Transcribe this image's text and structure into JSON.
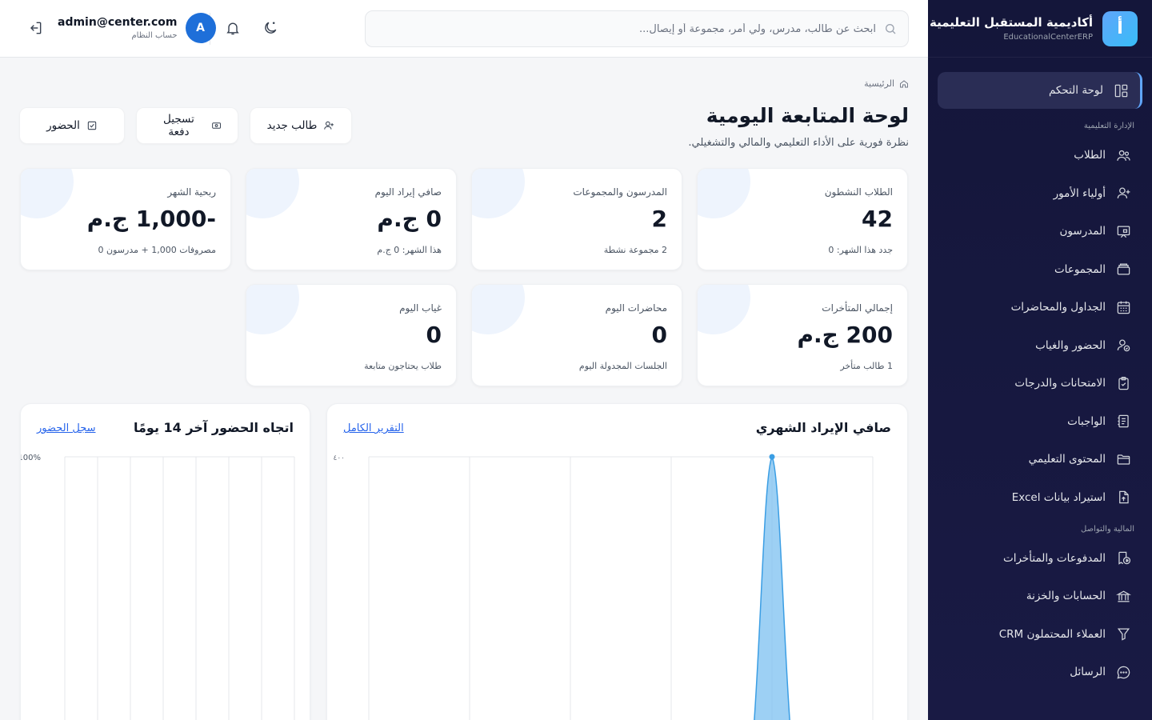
{
  "brand": {
    "name": "أكاديمية المستقبل التعليمية",
    "subtitle": "EducationalCenterERP",
    "logo_letter": "أ"
  },
  "sidebar": {
    "active": {
      "label": "لوحة التحكم",
      "icon": "dashboard-icon"
    },
    "sections": [
      {
        "title": "الإدارة التعليمية",
        "items": [
          {
            "label": "الطلاب",
            "icon": "users-icon"
          },
          {
            "label": "أولياء الأمور",
            "icon": "user-plus-icon"
          },
          {
            "label": "المدرسون",
            "icon": "presentation-icon"
          },
          {
            "label": "المجموعات",
            "icon": "archive-icon"
          },
          {
            "label": "الجداول والمحاضرات",
            "icon": "calendar-icon"
          },
          {
            "label": "الحضور والغياب",
            "icon": "user-check-icon"
          },
          {
            "label": "الامتحانات والدرجات",
            "icon": "clipboard-icon"
          },
          {
            "label": "الواجبات",
            "icon": "notebook-icon"
          },
          {
            "label": "المحتوى التعليمي",
            "icon": "folder-icon"
          },
          {
            "label": "استيراد بيانات Excel",
            "icon": "file-upload-icon"
          }
        ]
      },
      {
        "title": "المالية والتواصل",
        "items": [
          {
            "label": "المدفوعات والمتأخرات",
            "icon": "receipt-icon"
          },
          {
            "label": "الحسابات والخزنة",
            "icon": "bank-icon"
          },
          {
            "label": "العملاء المحتملون CRM",
            "icon": "funnel-icon"
          },
          {
            "label": "الرسائل",
            "icon": "chat-icon"
          }
        ]
      }
    ]
  },
  "header": {
    "search_placeholder": "ابحث عن طالب، مدرس، ولي أمر، مجموعة أو إيصال...",
    "user_email": "admin@center.com",
    "user_role": "حساب النظام",
    "avatar_letter": "A"
  },
  "page": {
    "breadcrumb": "الرئيسية",
    "title": "لوحة المتابعة اليومية",
    "subtitle": "نظرة فورية على الأداء التعليمي والمالي والتشغيلي."
  },
  "actions": {
    "new_student": "طالب جديد",
    "record_payment": "تسجيل دفعة",
    "attendance": "الحضور"
  },
  "stats": [
    {
      "label": "الطلاب النشطون",
      "value": "42",
      "foot": "جدد هذا الشهر: 0"
    },
    {
      "label": "المدرسون والمجموعات",
      "value": "2",
      "foot": "2 مجموعة نشطة"
    },
    {
      "label": "صافي إيراد اليوم",
      "value": "0 ج.م",
      "foot": "هذا الشهر: 0 ج.م"
    },
    {
      "label": "ربحية الشهر",
      "value": "-1,000 ج.م",
      "foot": "مصروفات 1,000 + مدرسون 0"
    },
    {
      "label": "إجمالي المتأخرات",
      "value": "200 ج.م",
      "foot": "1 طالب متأخر"
    },
    {
      "label": "محاضرات اليوم",
      "value": "0",
      "foot": "الجلسات المجدولة اليوم"
    },
    {
      "label": "غياب اليوم",
      "value": "0",
      "foot": "طلاب يحتاجون متابعة"
    }
  ],
  "panels": {
    "revenue": {
      "title": "صافي الإيراد الشهري",
      "link": "التقرير الكامل"
    },
    "attendance": {
      "title": "اتجاه الحضور آخر 14 يومًا",
      "link": "سجل الحضور"
    }
  },
  "chart_data": [
    {
      "type": "area",
      "title": "صافي الإيراد الشهري",
      "ytick_top": "٤٠٠",
      "ylim": [
        0,
        400
      ],
      "peak_value": 400,
      "color": "#7cc0f0"
    },
    {
      "type": "line",
      "title": "اتجاه الحضور آخر 14 يومًا",
      "ytick_top": "100%",
      "ylim": [
        0,
        100
      ]
    }
  ],
  "colors": {
    "sidebar_bg": "#14163a",
    "accent": "#60a5fa",
    "avatar": "#1e6fd9",
    "link": "#2563eb"
  }
}
